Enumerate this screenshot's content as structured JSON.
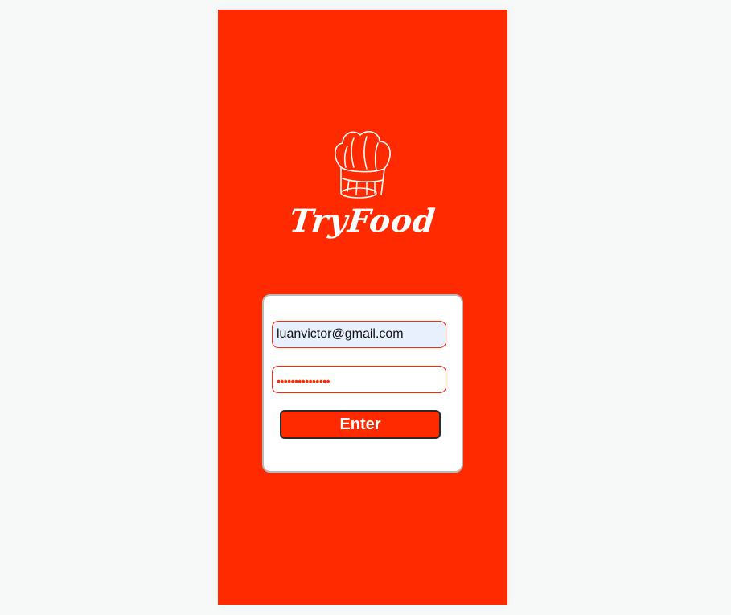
{
  "app": {
    "brand_name": "TryFood",
    "logo_icon": "chef-hat-icon",
    "accent_color": "#ff2a00"
  },
  "login": {
    "email_value": "luanvictor@gmail.com",
    "password_mask": "•••••••••••••••",
    "enter_label": "Enter"
  }
}
